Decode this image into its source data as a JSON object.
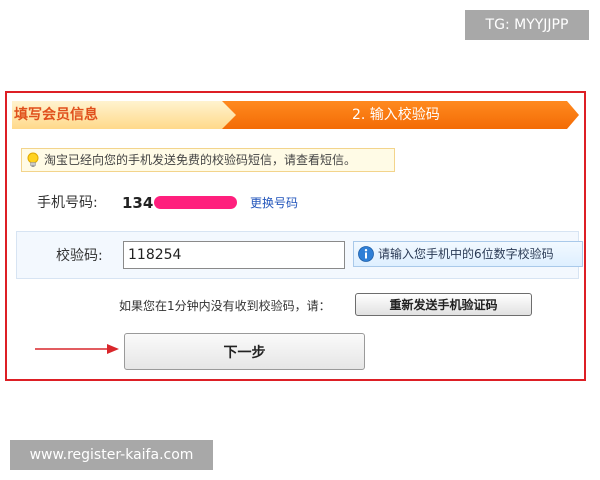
{
  "watermarks": {
    "top": "TG: MYYJJPP",
    "bottom": "www.register-kaifa.com"
  },
  "steps": {
    "step1_label": "填写会员信息",
    "step2_label": "2. 输入校验码"
  },
  "notice": {
    "icon": "lightbulb-icon",
    "text": "淘宝已经向您的手机发送免费的校验码短信，请查看短信。"
  },
  "phone": {
    "label": "手机号码:",
    "value_visible": "134",
    "change_link": "更换号码"
  },
  "code": {
    "label": "校验码:",
    "value": "118254",
    "hint_icon": "info-icon",
    "hint": "请输入您手机中的6位数字校验码"
  },
  "resend": {
    "text": "如果您在1分钟内没有收到校验码，请：",
    "button": "重新发送手机验证码"
  },
  "next": {
    "button": "下一步"
  },
  "colors": {
    "frame_border": "#dd1f25",
    "step_active": "#f36b05",
    "step_done_bg": "#ffd98a",
    "link": "#2255bb",
    "arrow": "#d9262b",
    "redaction": "#ff1f7d"
  }
}
